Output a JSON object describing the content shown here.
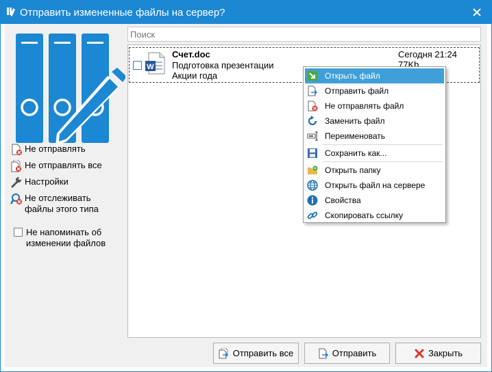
{
  "window": {
    "title": "Отправить измененные файлы на сервер?",
    "accent": "#1c87d3"
  },
  "sidebar": {
    "items": [
      {
        "label": "Не отправлять",
        "icon": "document-no-icon"
      },
      {
        "label": "Не отправлять все",
        "icon": "documents-no-icon"
      },
      {
        "label": "Настройки",
        "icon": "wrench-icon"
      },
      {
        "label": "Не отслеживать файлы этого типа",
        "line1": "Не отслеживать",
        "line2": "файлы этого типа",
        "icon": "stop-tracking-icon"
      }
    ],
    "remind_checkbox": {
      "line1": "Не напоминать об",
      "line2": "изменении файлов",
      "checked": false
    }
  },
  "search": {
    "placeholder": "Поиск"
  },
  "files": [
    {
      "name": "Счет.doc",
      "desc1": "Подготовка презентации",
      "desc2": "Акции года",
      "date": "Сегодня 21:24",
      "size": "77Kb",
      "icon": "word-document-icon",
      "checked": false
    }
  ],
  "context_menu": {
    "items": [
      {
        "label": "Открыть файл",
        "icon": "open-file-icon",
        "active": true
      },
      {
        "label": "Отправить файл",
        "icon": "send-file-icon"
      },
      {
        "label": "Не отправлять файл",
        "icon": "dont-send-icon"
      },
      {
        "label": "Заменить файл",
        "icon": "replace-icon"
      },
      {
        "label": "Переименовать",
        "icon": "rename-icon"
      },
      {
        "label": "Сохранить как...",
        "icon": "save-icon"
      },
      {
        "label": "Открыть папку",
        "icon": "open-folder-icon"
      },
      {
        "label": "Открыть файл на сервере",
        "icon": "globe-icon"
      },
      {
        "label": "Свойства",
        "icon": "info-icon"
      },
      {
        "label": "Скопировать ссылку",
        "icon": "link-icon"
      }
    ]
  },
  "buttons": {
    "send_all": "Отправить все",
    "send": "Отправить",
    "close": "Закрыть"
  }
}
